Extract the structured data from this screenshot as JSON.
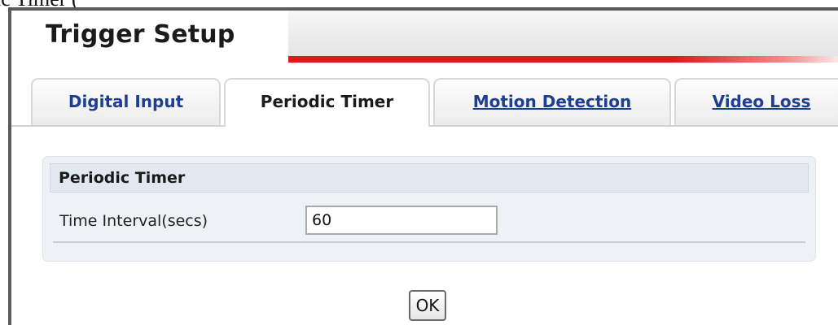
{
  "caption_fragment": "ic Timer (",
  "page": {
    "title": "Trigger Setup"
  },
  "tabs": [
    {
      "label": "Digital Input",
      "active": false,
      "link": false
    },
    {
      "label": "Periodic Timer",
      "active": true,
      "link": false
    },
    {
      "label": "Motion Detection",
      "active": false,
      "link": true
    },
    {
      "label": "Video Loss",
      "active": false,
      "link": true
    }
  ],
  "panel": {
    "title": "Periodic Timer",
    "field": {
      "label": "Time Interval(secs)",
      "value": "60"
    }
  },
  "buttons": {
    "ok_label": "OK"
  },
  "colors": {
    "accent_red": "#e01818",
    "tab_link_blue": "#1c3f94",
    "panel_bg": "#eef2f6"
  }
}
